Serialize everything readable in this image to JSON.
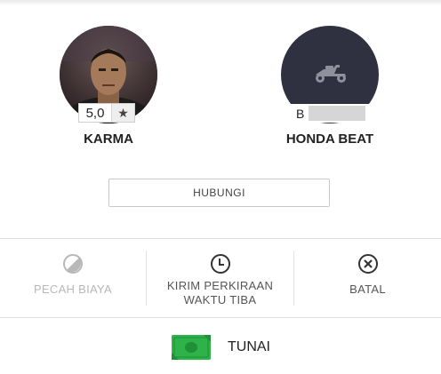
{
  "driver": {
    "name": "KARMA",
    "rating": "5,0"
  },
  "vehicle": {
    "name": "HONDA BEAT",
    "plate_visible": "B"
  },
  "contact_button": {
    "label": "HUBUNGI"
  },
  "actions": [
    {
      "label": "PECAH BIAYA",
      "icon": "split-fare-icon",
      "enabled": false
    },
    {
      "label_line1": "KIRIM PERKIRAAN",
      "label_line2": "WAKTU TIBA",
      "icon": "clock-icon",
      "enabled": true
    },
    {
      "label": "BATAL",
      "icon": "close-circle-icon",
      "enabled": true
    }
  ],
  "payment": {
    "label": "TUNAI",
    "icon": "cash-icon"
  },
  "colors": {
    "text_dark": "#222222",
    "text_mid": "#555555",
    "text_disabled": "#b8b8b8",
    "vehicle_bg": "#2f3140",
    "cash_green": "#2db34a"
  }
}
